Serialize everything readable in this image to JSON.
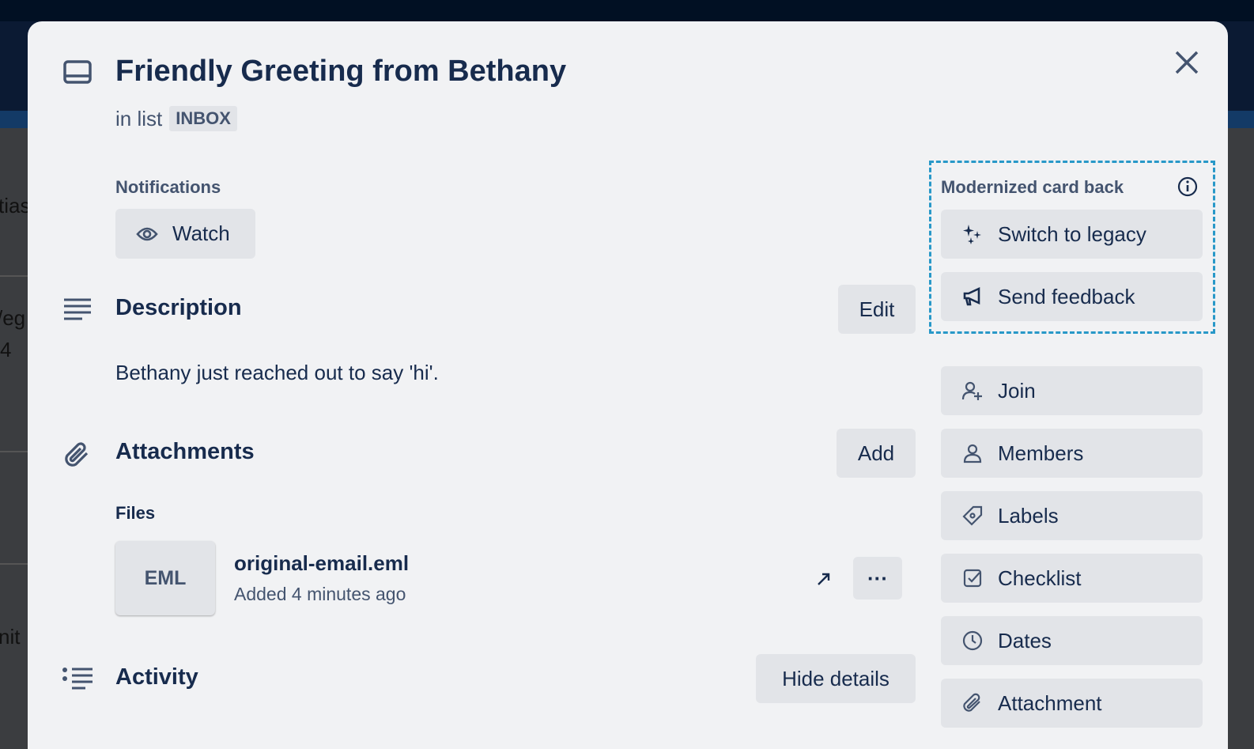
{
  "background": {
    "fragments": [
      "tias",
      "/eg",
      "4",
      "nit"
    ]
  },
  "card": {
    "title": "Friendly Greeting from Bethany",
    "in_list_prefix": "in list",
    "list_name": "INBOX"
  },
  "notifications": {
    "label": "Notifications",
    "watch_label": "Watch"
  },
  "description": {
    "heading": "Description",
    "edit_label": "Edit",
    "text": "Bethany just reached out to say 'hi'."
  },
  "attachments": {
    "heading": "Attachments",
    "add_label": "Add",
    "files_label": "Files",
    "files": [
      {
        "thumb": "EML",
        "name": "original-email.eml",
        "meta": "Added 4 minutes ago"
      }
    ]
  },
  "activity": {
    "heading": "Activity",
    "hide_details_label": "Hide details"
  },
  "modernized": {
    "label": "Modernized card back",
    "switch_label": "Switch to legacy",
    "feedback_label": "Send feedback",
    "accent": "#2898c8"
  },
  "sidebar": {
    "items": [
      {
        "label": "Join",
        "icon": "add-person-icon"
      },
      {
        "label": "Members",
        "icon": "person-icon"
      },
      {
        "label": "Labels",
        "icon": "tag-icon"
      },
      {
        "label": "Checklist",
        "icon": "checkbox-icon"
      },
      {
        "label": "Dates",
        "icon": "clock-icon"
      },
      {
        "label": "Attachment",
        "icon": "paperclip-icon"
      }
    ]
  }
}
